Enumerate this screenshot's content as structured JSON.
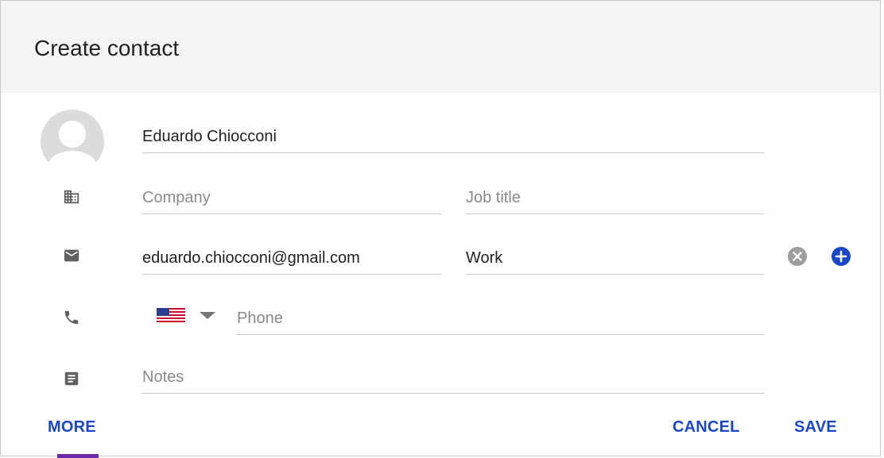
{
  "dialog": {
    "title": "Create contact"
  },
  "fields": {
    "name": {
      "value": "Eduardo Chiocconi",
      "placeholder": ""
    },
    "company": {
      "value": "",
      "placeholder": "Company"
    },
    "job_title": {
      "value": "",
      "placeholder": "Job title"
    },
    "email": {
      "value": "eduardo.chiocconi@gmail.com",
      "placeholder": ""
    },
    "email_label": {
      "value": "Work",
      "placeholder": ""
    },
    "phone": {
      "value": "",
      "placeholder": "Phone"
    },
    "notes": {
      "value": "",
      "placeholder": "Notes"
    }
  },
  "phone_country": {
    "selected": "US",
    "icon": "us-flag-icon"
  },
  "actions": {
    "more": "MORE",
    "cancel": "CANCEL",
    "save": "SAVE"
  },
  "icons": {
    "company": "building-icon",
    "email": "email-icon",
    "phone": "phone-icon",
    "notes": "notes-icon",
    "remove": "remove-circle-icon",
    "add": "add-circle-icon"
  },
  "colors": {
    "accent": "#1a47c7",
    "header_bg": "#f4f4f4",
    "icon": "#616161",
    "remove_icon": "#9e9e9e"
  }
}
